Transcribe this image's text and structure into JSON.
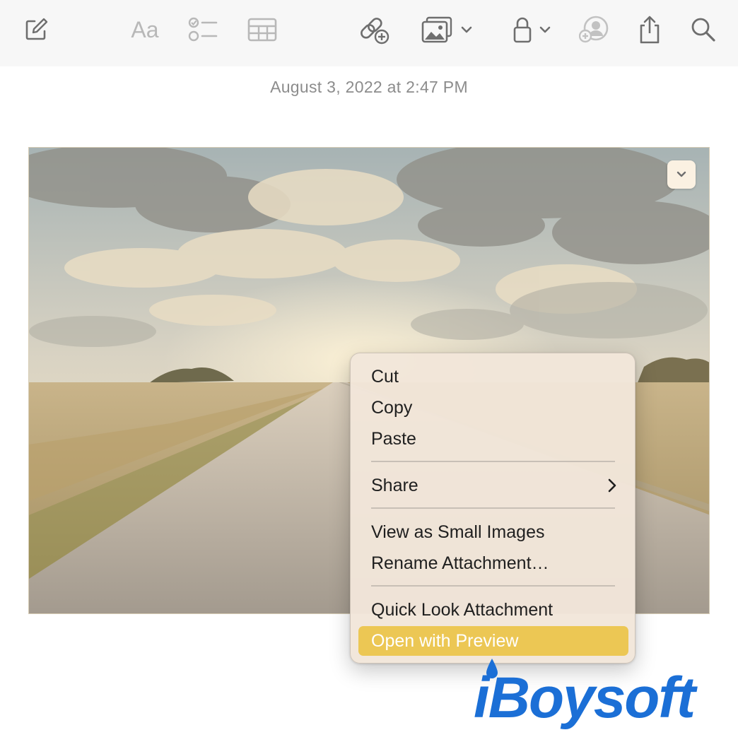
{
  "toolbar": {
    "buttons": [
      {
        "name": "compose",
        "icon": "compose-icon"
      },
      {
        "name": "format",
        "icon": "text-format-icon",
        "label": "Aa"
      },
      {
        "name": "checklist",
        "icon": "checklist-icon"
      },
      {
        "name": "table",
        "icon": "table-icon"
      },
      {
        "name": "link",
        "icon": "link-add-icon"
      },
      {
        "name": "media",
        "icon": "photo-icon"
      },
      {
        "name": "lock",
        "icon": "lock-icon"
      },
      {
        "name": "collaborate",
        "icon": "add-person-icon"
      },
      {
        "name": "share",
        "icon": "share-icon"
      },
      {
        "name": "search",
        "icon": "search-icon"
      }
    ],
    "format_label": "Aa"
  },
  "note": {
    "date": "August 3, 2022 at 2:47 PM",
    "attachment": {
      "type": "photo",
      "description_icon": "landscape-road-photo"
    }
  },
  "context_menu": {
    "items": [
      {
        "label": "Cut"
      },
      {
        "label": "Copy"
      },
      {
        "label": "Paste"
      },
      {
        "label": "Share",
        "submenu": true
      },
      {
        "label": "View as Small Images"
      },
      {
        "label": "Rename Attachment…"
      },
      {
        "label": "Quick Look Attachment"
      },
      {
        "label": "Open with Preview",
        "highlighted": true
      }
    ]
  },
  "watermark": {
    "text": "iBoysoft"
  },
  "colors": {
    "toolbar_bg": "#f7f7f7",
    "icon_gray": "#6e6e6e",
    "icon_light": "#b8b8b8",
    "highlight": "#ecc754",
    "watermark_blue": "#1b6fd6"
  }
}
